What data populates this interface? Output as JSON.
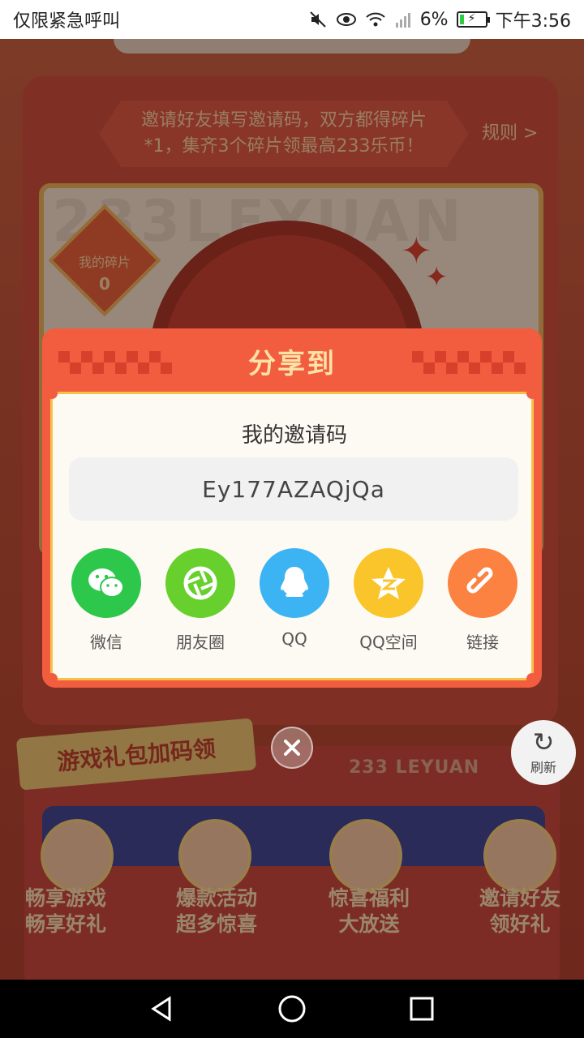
{
  "status_bar": {
    "carrier_text": "仅限紧急呼叫",
    "battery_percent": "6%",
    "time": "下午3:56"
  },
  "background": {
    "invite_banner": "邀请好友填写邀请码，双方都得碎片*1，集齐3个碎片领最高233乐币！",
    "rules_link": "规则 >",
    "fragments_label": "我的碎片",
    "fragments_count": "0",
    "gift_section_title": "游戏礼包加码领",
    "brand_text": "233 LEYUAN",
    "features": [
      {
        "line1": "畅享游戏",
        "line2": "畅享好礼"
      },
      {
        "line1": "爆款活动",
        "line2": "超多惊喜"
      },
      {
        "line1": "惊喜福利",
        "line2": "大放送"
      },
      {
        "line1": "邀请好友",
        "line2": "领好礼"
      }
    ],
    "refresh_label": "刷新"
  },
  "modal": {
    "title": "分享到",
    "invite_code_label": "我的邀请码",
    "invite_code": "Ey177AZAQjQa",
    "share_options": [
      {
        "label": "微信",
        "icon": "wechat-icon",
        "color": "#2dc74c"
      },
      {
        "label": "朋友圈",
        "icon": "moments-icon",
        "color": "#67d02c"
      },
      {
        "label": "QQ",
        "icon": "qq-icon",
        "color": "#3cb3f2"
      },
      {
        "label": "QQ空间",
        "icon": "qzone-icon",
        "color": "#f9c52a"
      },
      {
        "label": "链接",
        "icon": "link-icon",
        "color": "#fb8240"
      }
    ]
  },
  "colors": {
    "modal_frame": "#f25c3f",
    "modal_title": "#ffe2a6",
    "modal_border": "#f6c24a"
  }
}
